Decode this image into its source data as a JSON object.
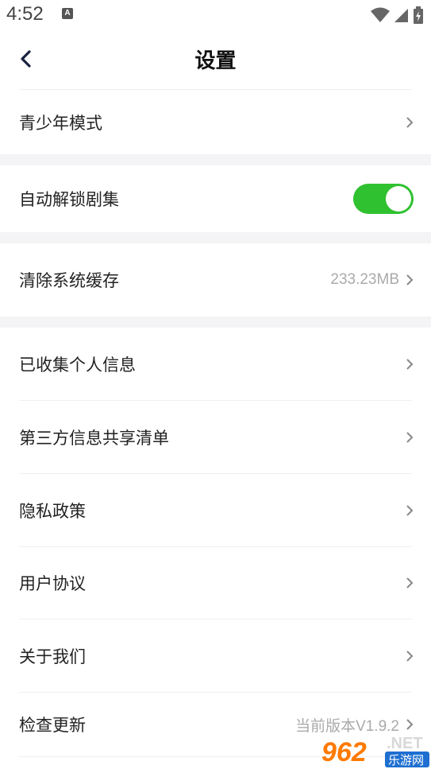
{
  "status_bar": {
    "time": "4:52",
    "notification_badge": "A"
  },
  "header": {
    "title": "设置"
  },
  "rows": {
    "teen_mode": {
      "label": "青少年模式"
    },
    "auto_unlock": {
      "label": "自动解锁剧集",
      "toggle_on": true
    },
    "clear_cache": {
      "label": "清除系统缓存",
      "value": "233.23MB"
    },
    "personal_info": {
      "label": "已收集个人信息"
    },
    "third_party": {
      "label": "第三方信息共享清单"
    },
    "privacy": {
      "label": "隐私政策"
    },
    "user_agreement": {
      "label": "用户协议"
    },
    "about": {
      "label": "关于我们"
    },
    "check_update": {
      "label": "检查更新",
      "value": "当前版本V1.9.2"
    }
  },
  "watermark": {
    "number": "962",
    "suffix": ".NET",
    "site": "乐游网"
  },
  "colors": {
    "toggle_on": "#30c130",
    "section_gap": "#f4f4f6",
    "value_text": "#aaaaaa"
  }
}
